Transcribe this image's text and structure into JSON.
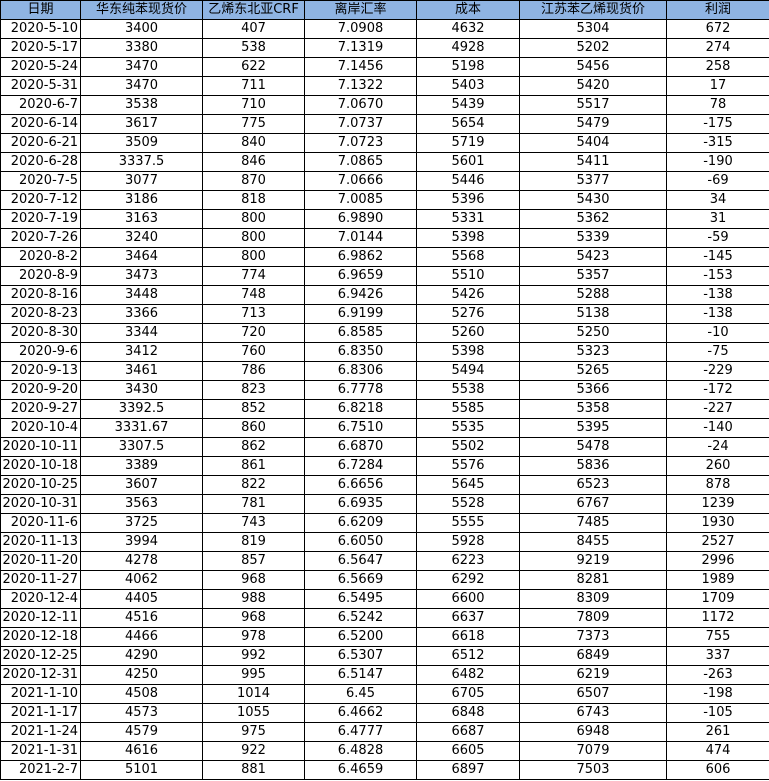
{
  "table": {
    "headers": [
      "日期",
      "华东纯苯现货价",
      "乙烯东北亚CRF",
      "离岸汇率",
      "成本",
      "江苏苯乙烯现货价",
      "利润"
    ],
    "rows": [
      [
        "2020-5-10",
        "3400",
        "407",
        "7.0908",
        "4632",
        "5304",
        "672"
      ],
      [
        "2020-5-17",
        "3380",
        "538",
        "7.1319",
        "4928",
        "5202",
        "274"
      ],
      [
        "2020-5-24",
        "3470",
        "622",
        "7.1456",
        "5198",
        "5456",
        "258"
      ],
      [
        "2020-5-31",
        "3470",
        "711",
        "7.1322",
        "5403",
        "5420",
        "17"
      ],
      [
        "2020-6-7",
        "3538",
        "710",
        "7.0670",
        "5439",
        "5517",
        "78"
      ],
      [
        "2020-6-14",
        "3617",
        "775",
        "7.0737",
        "5654",
        "5479",
        "-175"
      ],
      [
        "2020-6-21",
        "3509",
        "840",
        "7.0723",
        "5719",
        "5404",
        "-315"
      ],
      [
        "2020-6-28",
        "3337.5",
        "846",
        "7.0865",
        "5601",
        "5411",
        "-190"
      ],
      [
        "2020-7-5",
        "3077",
        "870",
        "7.0666",
        "5446",
        "5377",
        "-69"
      ],
      [
        "2020-7-12",
        "3186",
        "818",
        "7.0085",
        "5396",
        "5430",
        "34"
      ],
      [
        "2020-7-19",
        "3163",
        "800",
        "6.9890",
        "5331",
        "5362",
        "31"
      ],
      [
        "2020-7-26",
        "3240",
        "800",
        "7.0144",
        "5398",
        "5339",
        "-59"
      ],
      [
        "2020-8-2",
        "3464",
        "800",
        "6.9862",
        "5568",
        "5423",
        "-145"
      ],
      [
        "2020-8-9",
        "3473",
        "774",
        "6.9659",
        "5510",
        "5357",
        "-153"
      ],
      [
        "2020-8-16",
        "3448",
        "748",
        "6.9426",
        "5426",
        "5288",
        "-138"
      ],
      [
        "2020-8-23",
        "3366",
        "713",
        "6.9199",
        "5276",
        "5138",
        "-138"
      ],
      [
        "2020-8-30",
        "3344",
        "720",
        "6.8585",
        "5260",
        "5250",
        "-10"
      ],
      [
        "2020-9-6",
        "3412",
        "760",
        "6.8350",
        "5398",
        "5323",
        "-75"
      ],
      [
        "2020-9-13",
        "3461",
        "786",
        "6.8306",
        "5494",
        "5265",
        "-229"
      ],
      [
        "2020-9-20",
        "3430",
        "823",
        "6.7778",
        "5538",
        "5366",
        "-172"
      ],
      [
        "2020-9-27",
        "3392.5",
        "852",
        "6.8218",
        "5585",
        "5358",
        "-227"
      ],
      [
        "2020-10-4",
        "3331.67",
        "860",
        "6.7510",
        "5535",
        "5395",
        "-140"
      ],
      [
        "2020-10-11",
        "3307.5",
        "862",
        "6.6870",
        "5502",
        "5478",
        "-24"
      ],
      [
        "2020-10-18",
        "3389",
        "861",
        "6.7284",
        "5576",
        "5836",
        "260"
      ],
      [
        "2020-10-25",
        "3607",
        "822",
        "6.6656",
        "5645",
        "6523",
        "878"
      ],
      [
        "2020-10-31",
        "3563",
        "781",
        "6.6935",
        "5528",
        "6767",
        "1239"
      ],
      [
        "2020-11-6",
        "3725",
        "743",
        "6.6209",
        "5555",
        "7485",
        "1930"
      ],
      [
        "2020-11-13",
        "3994",
        "819",
        "6.6050",
        "5928",
        "8455",
        "2527"
      ],
      [
        "2020-11-20",
        "4278",
        "857",
        "6.5647",
        "6223",
        "9219",
        "2996"
      ],
      [
        "2020-11-27",
        "4062",
        "968",
        "6.5669",
        "6292",
        "8281",
        "1989"
      ],
      [
        "2020-12-4",
        "4405",
        "988",
        "6.5495",
        "6600",
        "8309",
        "1709"
      ],
      [
        "2020-12-11",
        "4516",
        "968",
        "6.5242",
        "6637",
        "7809",
        "1172"
      ],
      [
        "2020-12-18",
        "4466",
        "978",
        "6.5200",
        "6618",
        "7373",
        "755"
      ],
      [
        "2020-12-25",
        "4290",
        "992",
        "6.5307",
        "6512",
        "6849",
        "337"
      ],
      [
        "2020-12-31",
        "4250",
        "995",
        "6.5147",
        "6482",
        "6219",
        "-263"
      ],
      [
        "2021-1-10",
        "4508",
        "1014",
        "6.45",
        "6705",
        "6507",
        "-198"
      ],
      [
        "2021-1-17",
        "4573",
        "1055",
        "6.4662",
        "6848",
        "6743",
        "-105"
      ],
      [
        "2021-1-24",
        "4579",
        "975",
        "6.4777",
        "6687",
        "6948",
        "261"
      ],
      [
        "2021-1-31",
        "4616",
        "922",
        "6.4828",
        "6605",
        "7079",
        "474"
      ],
      [
        "2021-2-7",
        "5101",
        "881",
        "6.4659",
        "6897",
        "7503",
        "606"
      ]
    ]
  }
}
